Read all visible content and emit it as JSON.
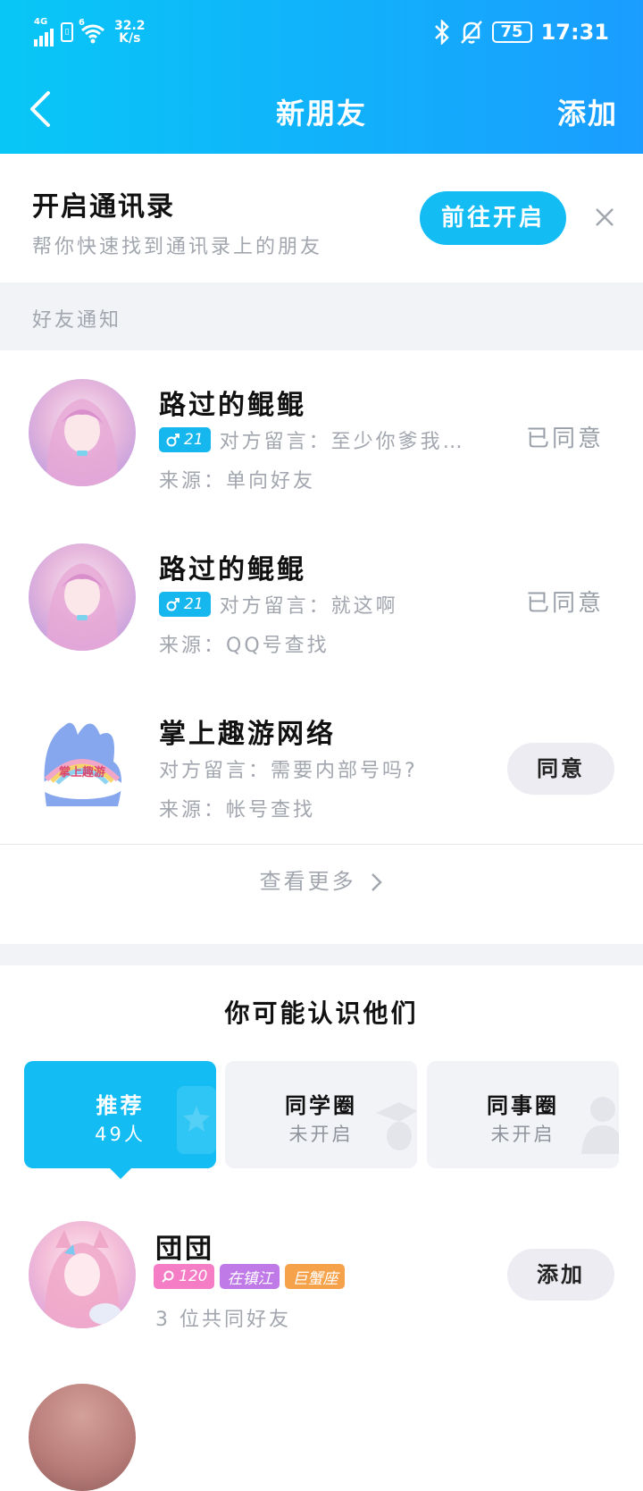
{
  "status_bar": {
    "network": "4G",
    "network2": "6",
    "speed_value": "32.2",
    "speed_unit": "K/s",
    "battery": "75",
    "time": "17:31"
  },
  "header": {
    "title": "新朋友",
    "add_label": "添加"
  },
  "contacts_banner": {
    "title": "开启通讯录",
    "subtitle": "帮你快速找到通讯录上的朋友",
    "button_label": "前往开启"
  },
  "notifications": {
    "section_label": "好友通知",
    "items": [
      {
        "name": "路过的鲲鲲",
        "badge": "21",
        "message": "对方留言：至少你爹我…",
        "source": "来源：单向好友",
        "status": "已同意"
      },
      {
        "name": "路过的鲲鲲",
        "badge": "21",
        "message": "对方留言：就这啊",
        "source": "来源：QQ号查找",
        "status": "已同意"
      },
      {
        "name": "掌上趣游网络",
        "message": "对方留言：需要内部号吗?",
        "source": "来源：帐号查找",
        "action": "同意",
        "avatar_text": "掌上趣游"
      }
    ],
    "more_label": "查看更多"
  },
  "suggestions": {
    "title": "你可能认识他们",
    "tabs": [
      {
        "label": "推荐",
        "sub": "49人",
        "active": true
      },
      {
        "label": "同学圈",
        "sub": "未开启",
        "active": false
      },
      {
        "label": "同事圈",
        "sub": "未开启",
        "active": false
      }
    ],
    "people": [
      {
        "name": "団団",
        "level_badge": "120",
        "location_badge": "在镇江",
        "zodiac_badge": "巨蟹座",
        "mutual": "3 位共同好友",
        "action": "添加"
      }
    ]
  },
  "colors": {
    "header_start": "#08c7f6",
    "header_end": "#1a9dff",
    "accent": "#13bdf4",
    "muted_text": "#a2a6ae"
  },
  "icons": [
    "back-arrow-icon",
    "close-icon",
    "chevron-right-icon",
    "male-icon",
    "search-level-icon",
    "star-icon",
    "graduation-icon",
    "person-icon",
    "bluetooth-icon",
    "mute-bell-icon",
    "wifi-icon",
    "signal-icon"
  ]
}
